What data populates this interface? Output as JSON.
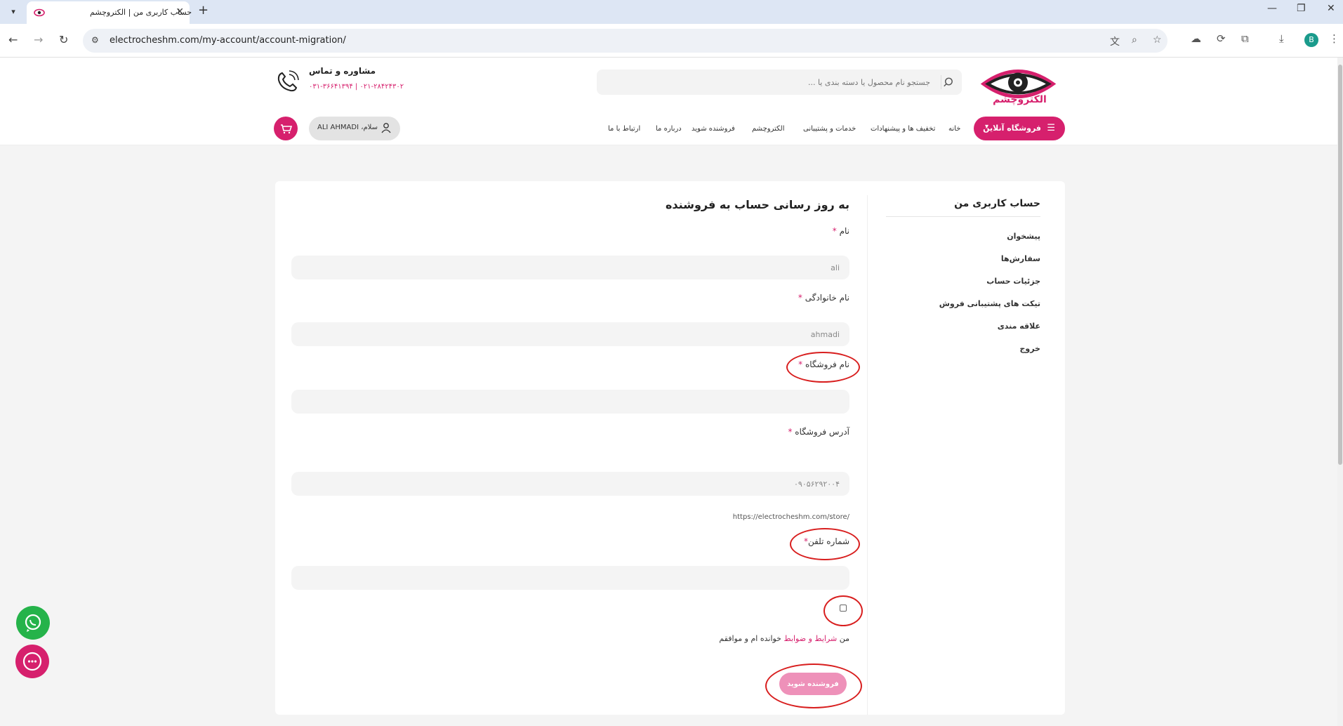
{
  "browser": {
    "tab_title": "حساب کاربری من | الکتروچشم",
    "url": "electrocheshm.com/my-account/account-migration/",
    "profile_initial": "B"
  },
  "header": {
    "logo_text": "الکتروچشم",
    "search_placeholder": "جستجو نام محصول یا دسته بندی یا ...",
    "contact_title": "مشاوره و تماس",
    "contact_phone": "۰۲۱-۲۸۴۲۴۳۰۲ | ۰۳۱-۳۶۶۴۱۳۹۴",
    "menu_button": "فروشگاه آنلاین",
    "nav": [
      "خانه",
      "تخفیف ها و پیشنهادات",
      "خدمات و پشتیبانی",
      "الکتروچشم",
      "فروشنده شوید",
      "درباره ما",
      "ارتباط با ما"
    ],
    "user_greeting": "سلام، ALI AHMADI"
  },
  "sidebar": {
    "title": "حساب کاربری من",
    "items": [
      "پیشخوان",
      "سفارش‌ها",
      "جزئیات حساب",
      "تیکت های پشتیبانی فروش",
      "علاقه مندی",
      "خروج"
    ]
  },
  "form": {
    "title": "به روز رسانی حساب به فروشنده",
    "first_name_label": "نام",
    "first_name_value": "ali",
    "last_name_label": "نام خانوادگی",
    "last_name_value": "ahmadi",
    "shop_name_label": "نام فروشگاه",
    "shop_name_value": "",
    "shop_address_label": "آدرس فروشگاه",
    "shop_address_value": "۰۹۰۵۶۲۹۲۰۰۴",
    "shop_url_hint": "https://electrocheshm.com/store/",
    "phone_label": "شماره تلفن",
    "phone_value": "",
    "required_mark": "*",
    "terms_prefix": "من",
    "terms_link": "شرایط و ضوابط",
    "terms_suffix": "خوانده ام و موافقم",
    "submit_label": "فروشنده شوید"
  }
}
